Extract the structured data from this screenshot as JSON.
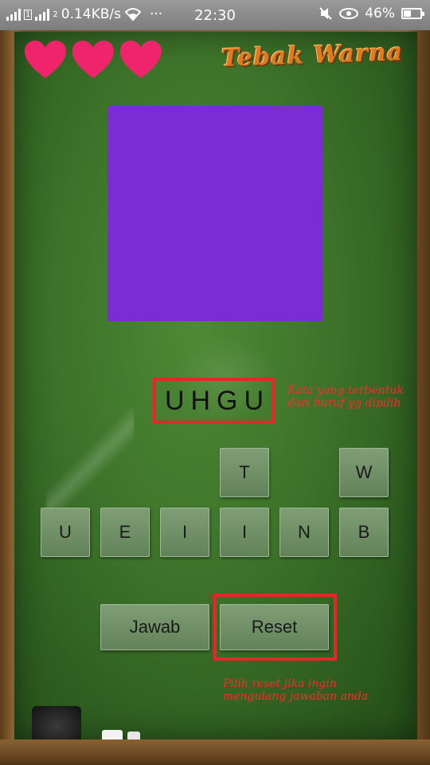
{
  "status_bar": {
    "network_speed": "0.14KB/s",
    "sim_label": "2",
    "more": "···",
    "time": "22:30",
    "battery": "46%",
    "battery_level": 0.46
  },
  "game": {
    "title": "Tebak Warna",
    "lives": 3,
    "swatch_color": "#7B2CD4",
    "current_word": "UHGU",
    "word_note": "Kata yang terbentuk dari huruf yg dipilih",
    "letters_row1": [
      "T",
      "W"
    ],
    "letters_row2": [
      "U",
      "E",
      "I",
      "I",
      "N",
      "B"
    ],
    "buttons": {
      "answer": "Jawab",
      "reset": "Reset"
    },
    "reset_note": "Pilih reset jika ingin mengulang jawaban anda"
  },
  "colors": {
    "heart": "#F0246A",
    "highlight": "#E8262A",
    "note_text": "#FF2A2A"
  }
}
